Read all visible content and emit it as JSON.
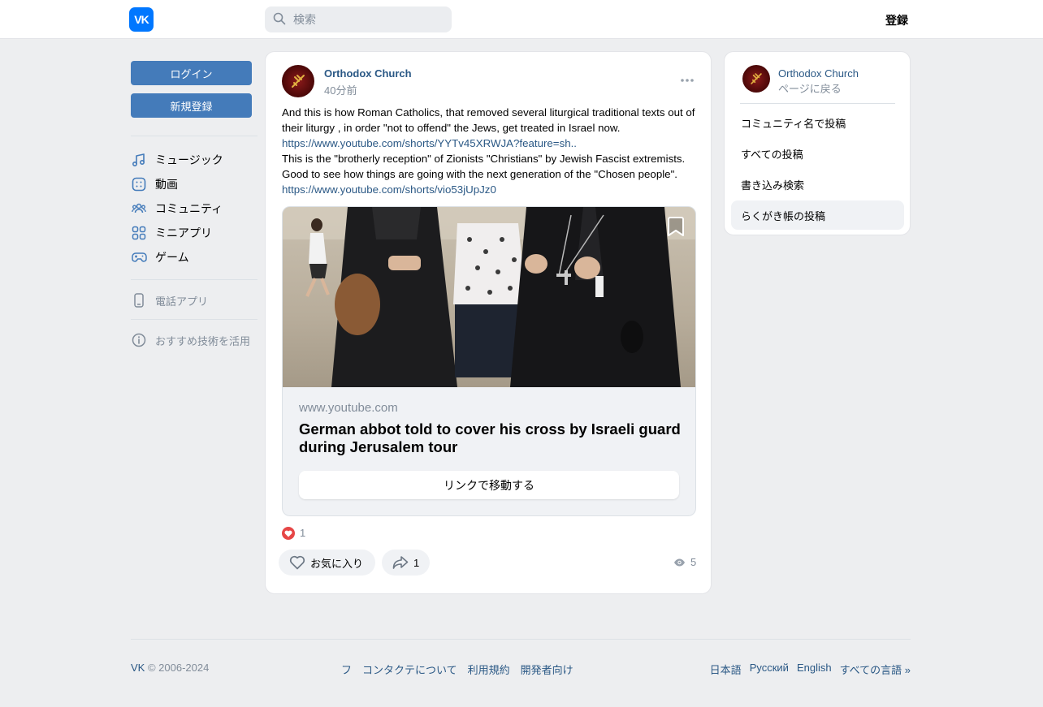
{
  "header": {
    "logo_text": "VK",
    "search_placeholder": "検索",
    "register_label": "登録"
  },
  "sidebar": {
    "login_label": "ログイン",
    "signup_label": "新規登録",
    "items": [
      {
        "label": "ミュージック",
        "icon": "music-icon"
      },
      {
        "label": "動画",
        "icon": "video-icon"
      },
      {
        "label": "コミュニティ",
        "icon": "community-icon"
      },
      {
        "label": "ミニアプリ",
        "icon": "mini-apps-icon"
      },
      {
        "label": "ゲーム",
        "icon": "gamepad-icon"
      }
    ],
    "phone_app_label": "電話アプリ",
    "recommend_label": "おすすめ技術を活用"
  },
  "post": {
    "author": "Orthodox Church",
    "time": "40分前",
    "text_line1": "And this is how Roman Catholics, that removed several liturgical traditional texts out of their liturgy , in order \"not to offend\" the Jews, get treated in Israel now.",
    "link1": "https://www.youtube.com/shorts/YYTv45XRWJA?feature=sh..",
    "text_line2": "This is the \"brotherly reception\" of Zionists \"Christians\" by Jewish Fascist extremists. Good to see how things are going with the next generation of the \"Chosen people\".",
    "link2": "https://www.youtube.com/shorts/vio53jUpJz0",
    "attachment": {
      "domain": "www.youtube.com",
      "title": "German abbot told to cover his cross by Israeli guard during Jerusalem tour",
      "button_label": "リンクで移動する"
    },
    "reaction_count": "1",
    "like_label": "お気に入り",
    "share_count": "1",
    "views_count": "5"
  },
  "right_panel": {
    "name": "Orthodox Church",
    "back_label": "ページに戻る",
    "items": [
      {
        "label": "コミュニティ名で投稿"
      },
      {
        "label": "すべての投稿"
      },
      {
        "label": "書き込み検索"
      },
      {
        "label": "らくがき帳の投稿"
      }
    ]
  },
  "footer": {
    "brand": "VK",
    "copyright": " © 2006-2024",
    "links": [
      "フ",
      "コンタクテについて",
      "利用規約",
      "開発者向け"
    ],
    "langs": [
      "日本語",
      "Русский",
      "English",
      "すべての言語 »"
    ]
  },
  "colors": {
    "accent": "#447bba",
    "link": "#2a5885",
    "muted": "#818c99",
    "background": "#edeef0",
    "brand": "#0077ff",
    "heart": "#e64646"
  }
}
